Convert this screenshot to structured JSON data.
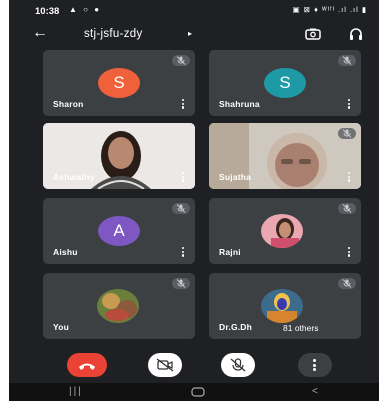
{
  "status_bar": {
    "time": "10:38",
    "left_icons": "▲ ○ ●",
    "right_icons": "▣ ⊠ ♦ ᵂᴵᶠᴵ .ıl .ıl ▮"
  },
  "meeting": {
    "title": "stj-jsfu-zdy"
  },
  "participants": [
    {
      "name": "Sharon",
      "initial": "S",
      "avatar_color": "#f0613b",
      "muted": true
    },
    {
      "name": "Shahruna",
      "initial": "S",
      "avatar_color": "#1e9aa6",
      "muted": true
    },
    {
      "name": "Ashwathy",
      "muted": false,
      "video": true
    },
    {
      "name": "Sujatha",
      "muted": true,
      "video": true
    },
    {
      "name": "Aishu",
      "initial": "A",
      "avatar_color": "#7e57c2",
      "muted": true
    },
    {
      "name": "Rajni",
      "muted": true,
      "photo": true
    },
    {
      "name": "You",
      "muted": true,
      "photo": true
    },
    {
      "name": "Dr.G.Dh",
      "muted": true,
      "photo": true,
      "others_label": "81 others"
    }
  ],
  "colors": {
    "background": "#1f2023",
    "tile": "#3c4043",
    "end_call": "#ea4335"
  },
  "icons": [
    "back-arrow-icon",
    "camera-switch-icon",
    "headset-icon",
    "mic-off-icon",
    "more-vert-icon",
    "end-call-icon",
    "video-off-icon"
  ]
}
